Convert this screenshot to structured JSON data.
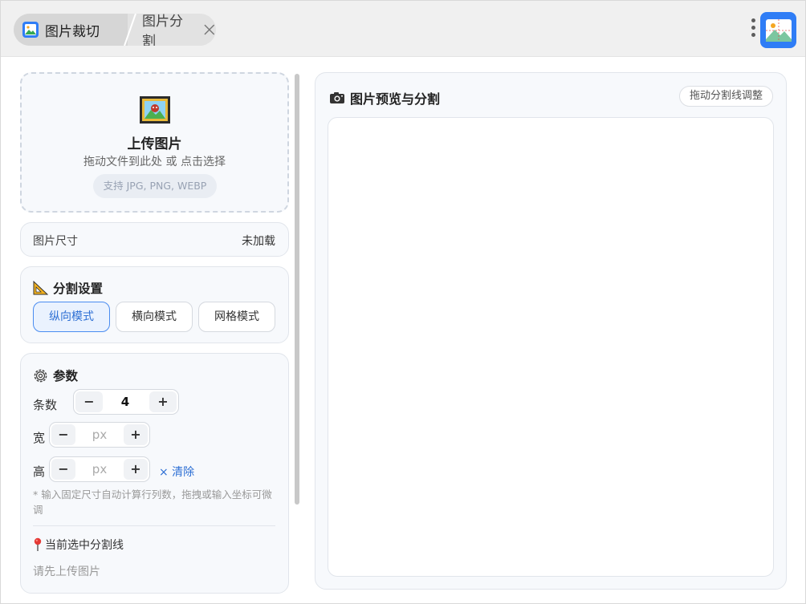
{
  "tabs": {
    "active_label": "图片裁切",
    "second_label": "图片分割"
  },
  "upload": {
    "title": "上传图片",
    "hint": "拖动文件到此处 或 点击选择",
    "formats": "支持 JPG, PNG, WEBP"
  },
  "image_size": {
    "label": "图片尺寸",
    "value": "未加载"
  },
  "split_settings": {
    "title": "分割设置",
    "modes": [
      "纵向模式",
      "横向模式",
      "网格模式"
    ],
    "active_mode": "纵向模式"
  },
  "params": {
    "title": "参数",
    "count_label": "条数",
    "count_value": "4",
    "width_label": "宽",
    "width_placeholder": "px",
    "height_label": "高",
    "height_placeholder": "px",
    "minus": "−",
    "plus": "+",
    "clear_label": "× 清除",
    "note": "* 输入固定尺寸自动计算行列数，拖拽或输入坐标可微调",
    "selected_line_title": "当前选中分割线",
    "selected_line_hint": "请先上传图片"
  },
  "preview": {
    "title": "图片预览与分割",
    "drag_tip": "拖动分割线调整"
  },
  "colors": {
    "accent": "#2f7df6",
    "link": "#2d6fd4",
    "panel_bg": "#f7f9fc"
  }
}
